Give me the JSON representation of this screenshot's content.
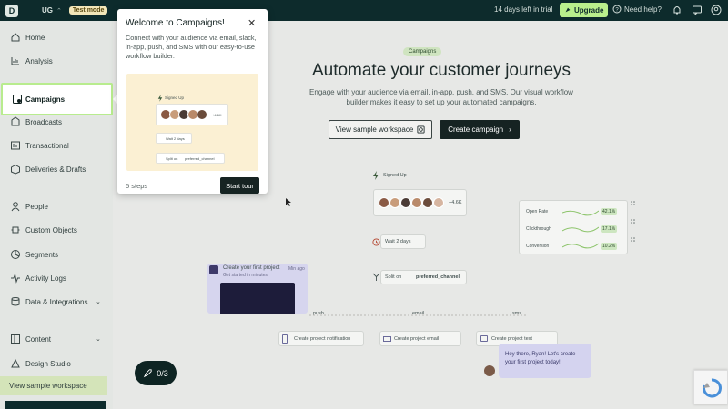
{
  "topbar": {
    "logo_letter": "D",
    "workspace": "UG",
    "test_mode": "Test mode",
    "trial_text": "14 days left in trial",
    "upgrade_label": "Upgrade",
    "help_label": "Need help?"
  },
  "sidebar": {
    "items": [
      {
        "label": "Home",
        "icon": "home-icon"
      },
      {
        "label": "Analysis",
        "icon": "analysis-icon"
      },
      {
        "label": "Campaigns",
        "icon": "campaigns-icon"
      },
      {
        "label": "Broadcasts",
        "icon": "broadcasts-icon"
      },
      {
        "label": "Transactional",
        "icon": "transactional-icon"
      },
      {
        "label": "Deliveries & Drafts",
        "icon": "deliveries-icon"
      },
      {
        "label": "People",
        "icon": "people-icon"
      },
      {
        "label": "Custom Objects",
        "icon": "objects-icon"
      },
      {
        "label": "Segments",
        "icon": "segments-icon"
      },
      {
        "label": "Activity Logs",
        "icon": "activity-icon"
      },
      {
        "label": "Data & Integrations",
        "icon": "data-icon"
      },
      {
        "label": "Content",
        "icon": "content-icon"
      },
      {
        "label": "Design Studio",
        "icon": "design-icon"
      }
    ],
    "sample_workspace": "View sample workspace"
  },
  "hero": {
    "pill": "Campaigns",
    "title": "Automate your customer journeys",
    "subtitle": "Engage with your audience via email, in-app, push, and SMS. Our visual workflow builder makes it easy to set up your automated campaigns.",
    "sample_button": "View sample workspace",
    "create_button": "Create campaign"
  },
  "flow": {
    "signed_up": "Signed Up",
    "more_count": "+4.6K",
    "wait": "Wait 2 days",
    "split": "Split on",
    "split_attr": "preferred_channel",
    "stats": [
      {
        "label": "Open Rate",
        "value": "42.1%"
      },
      {
        "label": "Clickthrough",
        "value": "17.1%"
      },
      {
        "label": "Conversion",
        "value": "10.2%"
      }
    ],
    "project_title": "Create your first project",
    "project_sub": "Get started in minutes",
    "project_time": "Min ago",
    "channels": [
      "push",
      "email",
      "sms"
    ],
    "actions": [
      "Create project notification",
      "Create project email",
      "Create project text"
    ],
    "chat": "Hey there, Ryan! Let's create your first project today!"
  },
  "popover": {
    "title": "Welcome to Campaigns!",
    "body": "Connect with your audience via email, slack, in-app, push, and SMS with our easy-to-use workflow builder.",
    "img_signed_up": "Signed Up",
    "img_more": "+4.6K",
    "img_wait": "Wait 2 days",
    "img_split": "Split on",
    "img_split_attr": "preferred_channel",
    "steps": "5 steps",
    "start_button": "Start tour"
  },
  "onboarding": {
    "progress": "0/3"
  },
  "colors": {
    "brand_dark": "#0d2b2c",
    "accent_green": "#b9ef8c",
    "active_border": "#b8ec8e"
  }
}
